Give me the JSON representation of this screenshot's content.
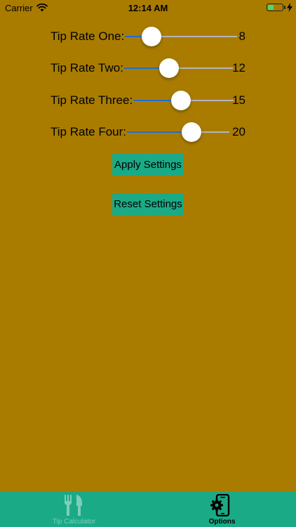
{
  "status_bar": {
    "carrier": "Carrier",
    "time": "12:14 AM",
    "battery_level": 0.42,
    "battery_color": "#4CD964"
  },
  "colors": {
    "background": "#A97C00",
    "accent": "#1AAA86",
    "slider_fill": "#1F6FCF",
    "tab_inactive": "#7FCDB8"
  },
  "settings": {
    "sliders": [
      {
        "label": "Tip Rate One:",
        "value": "8",
        "level": 0.24
      },
      {
        "label": "Tip Rate Two:",
        "value": "12",
        "level": 0.41
      },
      {
        "label": "Tip Rate Three:",
        "value": "15",
        "level": 0.47
      },
      {
        "label": "Tip Rate Four:",
        "value": "20",
        "level": 0.63
      }
    ],
    "apply_label": "Apply Settings",
    "reset_label": "Reset Settings"
  },
  "tabbar": {
    "tabs": [
      {
        "label": "Tip Calculator",
        "icon": "fork-knife-icon",
        "selected": false
      },
      {
        "label": "Options",
        "icon": "phone-gear-icon",
        "selected": true
      }
    ]
  }
}
